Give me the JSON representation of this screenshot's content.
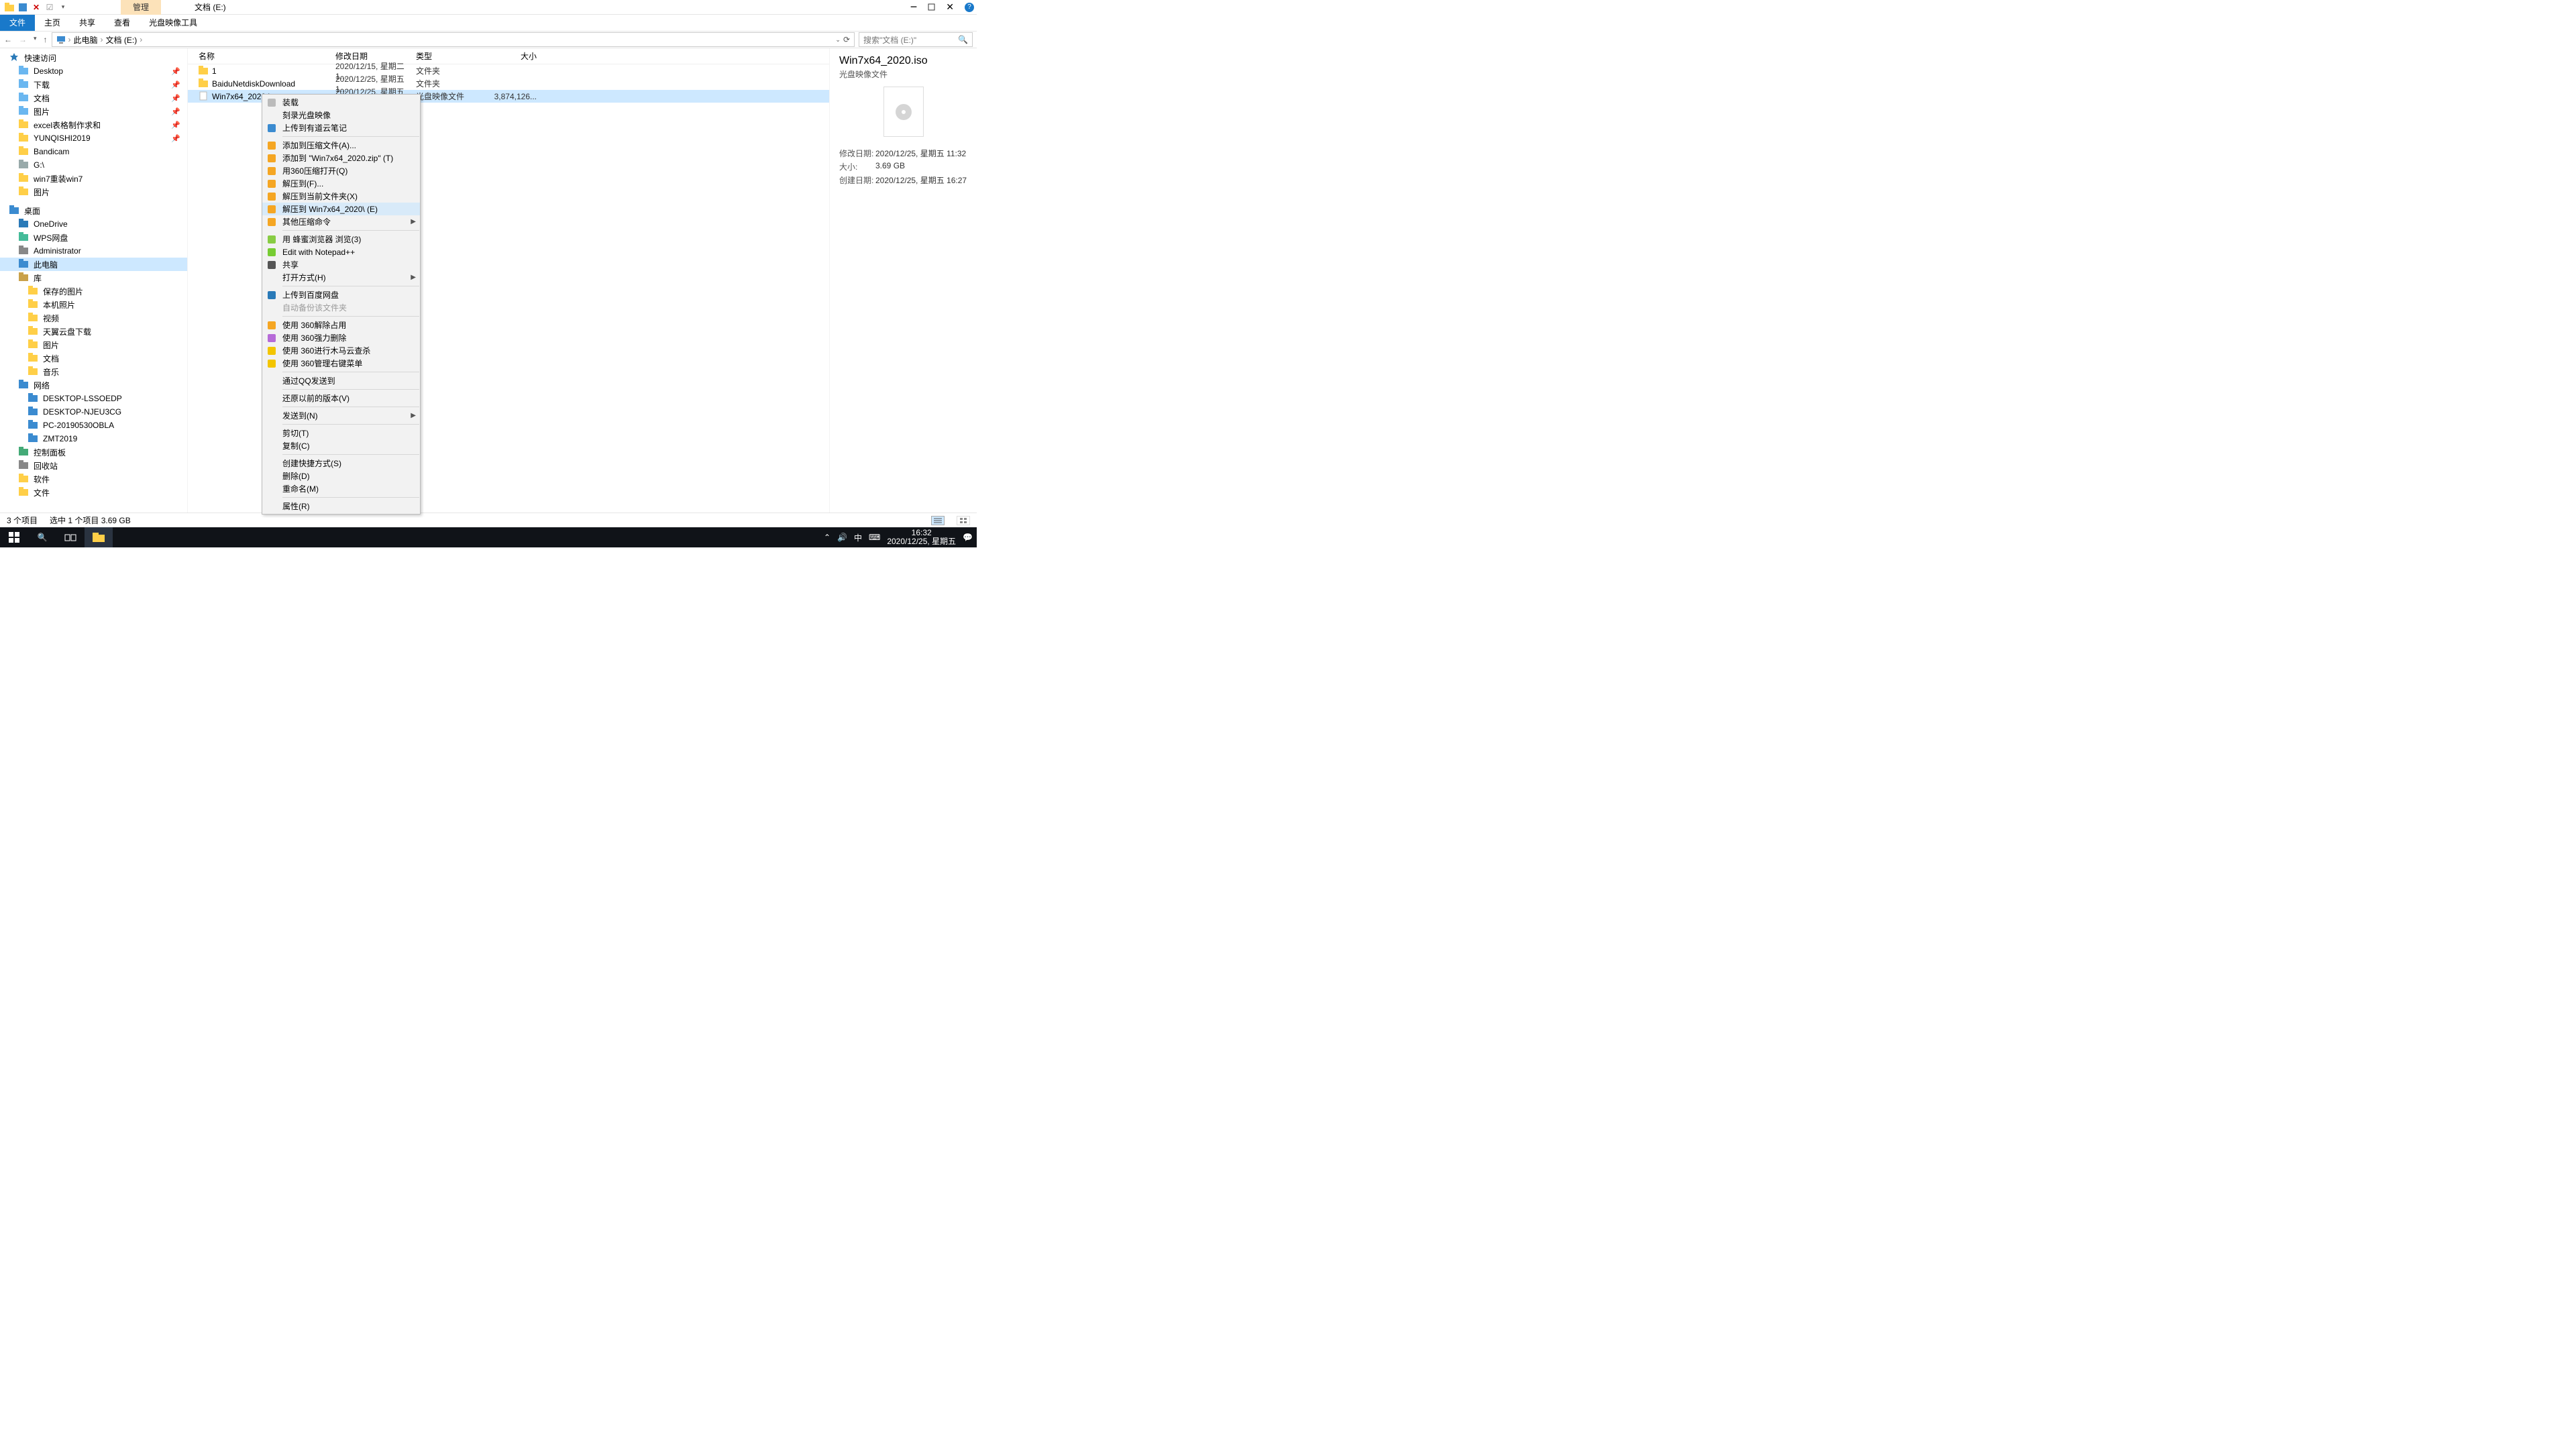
{
  "title_bar": {
    "context_tab": "管理",
    "window_title": "文档 (E:)"
  },
  "ribbon": {
    "tabs": [
      "文件",
      "主页",
      "共享",
      "查看",
      "光盘映像工具"
    ]
  },
  "address": {
    "root": "此电脑",
    "segs": [
      "文档 (E:)"
    ],
    "search_ph": "搜索\"文档 (E:)\""
  },
  "nav": [
    {
      "t": "快速访问",
      "ico": "star",
      "lv": 0
    },
    {
      "t": "Desktop",
      "ico": "folder-blue",
      "lv": 1,
      "pin": true
    },
    {
      "t": "下载",
      "ico": "folder-blue",
      "lv": 1,
      "pin": true
    },
    {
      "t": "文档",
      "ico": "folder-blue",
      "lv": 1,
      "pin": true
    },
    {
      "t": "图片",
      "ico": "folder-blue",
      "lv": 1,
      "pin": true
    },
    {
      "t": "excel表格制作求和",
      "ico": "folder",
      "lv": 1,
      "pin": true
    },
    {
      "t": "YUNQISHI2019",
      "ico": "folder",
      "lv": 1,
      "pin": true
    },
    {
      "t": "Bandicam",
      "ico": "folder",
      "lv": 1
    },
    {
      "t": "G:\\",
      "ico": "drive",
      "lv": 1
    },
    {
      "t": "win7重装win7",
      "ico": "folder",
      "lv": 1
    },
    {
      "t": "图片",
      "ico": "folder",
      "lv": 1
    },
    {
      "sp": true
    },
    {
      "t": "桌面",
      "ico": "desktop",
      "lv": 0
    },
    {
      "t": "OneDrive",
      "ico": "cloud",
      "lv": 1
    },
    {
      "t": "WPS网盘",
      "ico": "cloud-g",
      "lv": 1
    },
    {
      "t": "Administrator",
      "ico": "user",
      "lv": 1
    },
    {
      "t": "此电脑",
      "ico": "pc",
      "lv": 1,
      "sel": true
    },
    {
      "t": "库",
      "ico": "lib",
      "lv": 1
    },
    {
      "t": "保存的图片",
      "ico": "folder",
      "lv": 2
    },
    {
      "t": "本机照片",
      "ico": "folder",
      "lv": 2
    },
    {
      "t": "视频",
      "ico": "folder",
      "lv": 2
    },
    {
      "t": "天翼云盘下载",
      "ico": "folder",
      "lv": 2
    },
    {
      "t": "图片",
      "ico": "folder",
      "lv": 2
    },
    {
      "t": "文档",
      "ico": "folder",
      "lv": 2
    },
    {
      "t": "音乐",
      "ico": "folder",
      "lv": 2
    },
    {
      "t": "网络",
      "ico": "net",
      "lv": 1
    },
    {
      "t": "DESKTOP-LSSOEDP",
      "ico": "pc",
      "lv": 2
    },
    {
      "t": "DESKTOP-NJEU3CG",
      "ico": "pc",
      "lv": 2
    },
    {
      "t": "PC-20190530OBLA",
      "ico": "pc",
      "lv": 2
    },
    {
      "t": "ZMT2019",
      "ico": "pc",
      "lv": 2
    },
    {
      "t": "控制面板",
      "ico": "cp",
      "lv": 1
    },
    {
      "t": "回收站",
      "ico": "bin",
      "lv": 1
    },
    {
      "t": "软件",
      "ico": "folder",
      "lv": 1
    },
    {
      "t": "文件",
      "ico": "folder",
      "lv": 1
    }
  ],
  "columns": {
    "name": "名称",
    "date": "修改日期",
    "type": "类型",
    "size": "大小"
  },
  "rows": [
    {
      "n": "1",
      "d": "2020/12/15, 星期二 1...",
      "t": "文件夹",
      "s": "",
      "ico": "folder"
    },
    {
      "n": "BaiduNetdiskDownload",
      "d": "2020/12/25, 星期五 1...",
      "t": "文件夹",
      "s": "",
      "ico": "folder"
    },
    {
      "n": "Win7x64_2020.iso",
      "d": "2020/12/25, 星期五 1...",
      "t": "光盘映像文件",
      "s": "3,874,126...",
      "ico": "iso",
      "sel": true
    }
  ],
  "preview": {
    "title": "Win7x64_2020.iso",
    "sub": "光盘映像文件",
    "props": [
      {
        "k": "修改日期:",
        "v": "2020/12/25, 星期五 11:32"
      },
      {
        "k": "大小:",
        "v": "3.69 GB"
      },
      {
        "k": "创建日期:",
        "v": "2020/12/25, 星期五 16:27"
      }
    ]
  },
  "status": {
    "a": "3 个项目",
    "b": "选中 1 个项目  3.69 GB"
  },
  "taskbar": {
    "time": "16:32",
    "date": "2020/12/25, 星期五",
    "ime": "中"
  },
  "ctx": [
    {
      "t": "装载",
      "ico": "disc"
    },
    {
      "t": "刻录光盘映像"
    },
    {
      "t": "上传到有道云笔记",
      "ico": "note"
    },
    {
      "sep": true
    },
    {
      "t": "添加到压缩文件(A)...",
      "ico": "zip"
    },
    {
      "t": "添加到 \"Win7x64_2020.zip\" (T)",
      "ico": "zip"
    },
    {
      "t": "用360压缩打开(Q)",
      "ico": "zip"
    },
    {
      "t": "解压到(F)...",
      "ico": "zip"
    },
    {
      "t": "解压到当前文件夹(X)",
      "ico": "zip"
    },
    {
      "t": "解压到 Win7x64_2020\\ (E)",
      "ico": "zip",
      "hov": true
    },
    {
      "t": "其他压缩命令",
      "ico": "zip",
      "arrow": true
    },
    {
      "sep": true
    },
    {
      "t": "用 蜂蜜浏览器 浏览(3)",
      "ico": "bee"
    },
    {
      "t": "Edit with Notepad++",
      "ico": "npp"
    },
    {
      "t": "共享",
      "ico": "share"
    },
    {
      "t": "打开方式(H)",
      "arrow": true
    },
    {
      "sep": true
    },
    {
      "t": "上传到百度网盘",
      "ico": "baidu"
    },
    {
      "t": "自动备份该文件夹",
      "disabled": true
    },
    {
      "sep": true
    },
    {
      "t": "使用 360解除占用",
      "ico": "s360"
    },
    {
      "t": "使用 360强力删除",
      "ico": "s360b"
    },
    {
      "t": "使用 360进行木马云查杀",
      "ico": "s360y"
    },
    {
      "t": "使用 360管理右键菜单",
      "ico": "s360y"
    },
    {
      "sep": true
    },
    {
      "t": "通过QQ发送到"
    },
    {
      "sep": true
    },
    {
      "t": "还原以前的版本(V)"
    },
    {
      "sep": true
    },
    {
      "t": "发送到(N)",
      "arrow": true
    },
    {
      "sep": true
    },
    {
      "t": "剪切(T)"
    },
    {
      "t": "复制(C)"
    },
    {
      "sep": true
    },
    {
      "t": "创建快捷方式(S)"
    },
    {
      "t": "删除(D)"
    },
    {
      "t": "重命名(M)"
    },
    {
      "sep": true
    },
    {
      "t": "属性(R)"
    }
  ]
}
